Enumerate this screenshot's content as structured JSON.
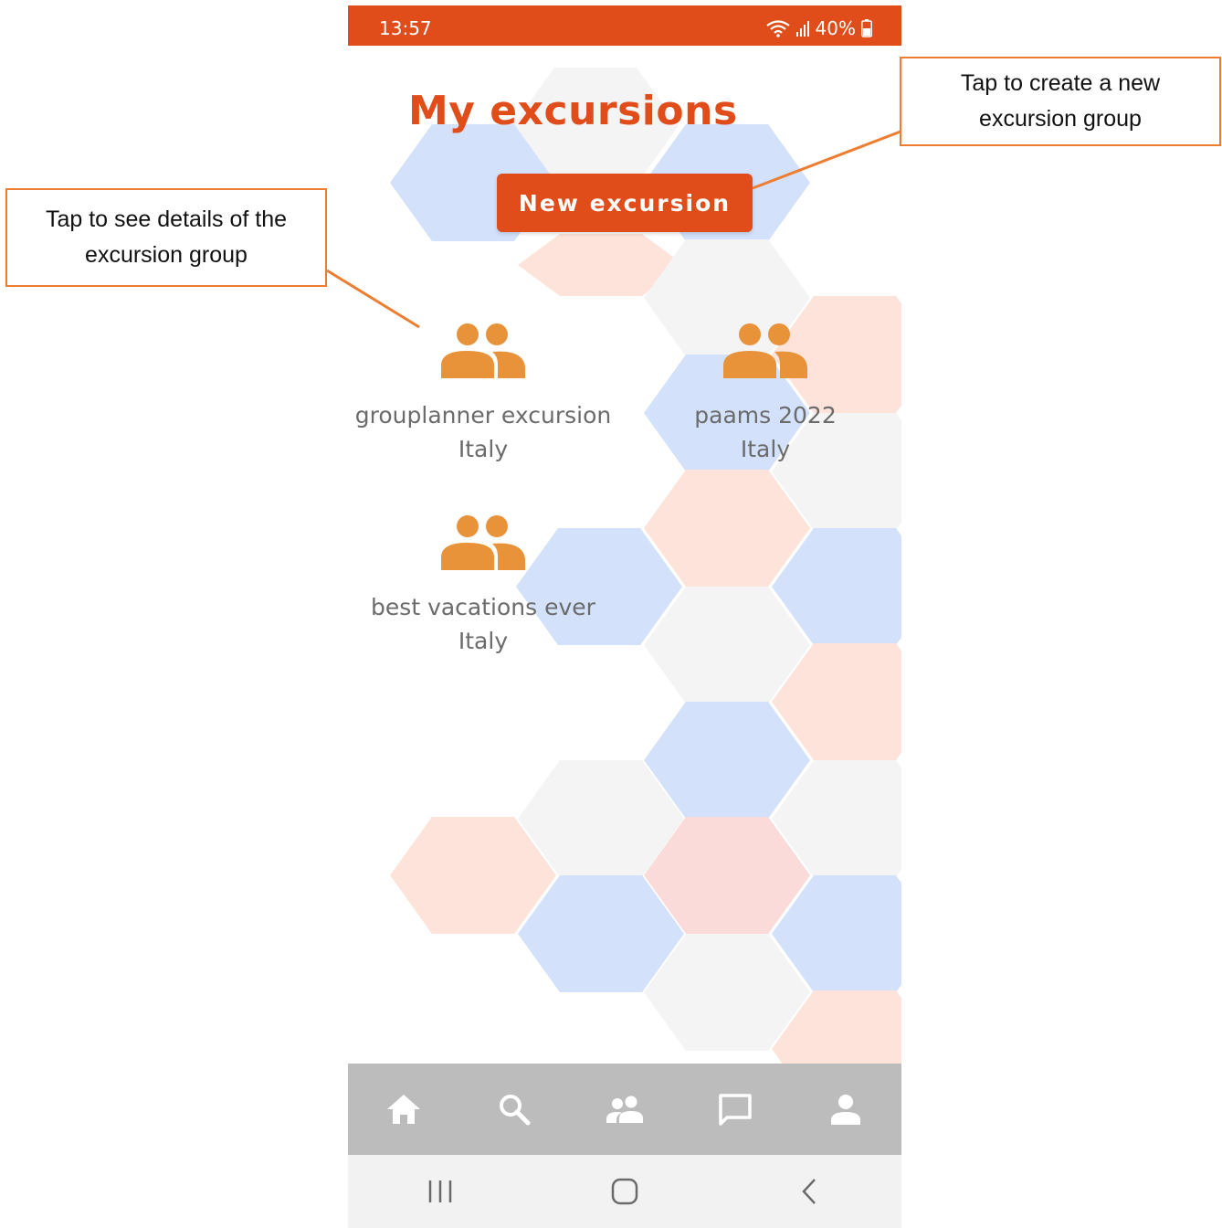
{
  "status_bar": {
    "time": "13:57",
    "battery": "40%"
  },
  "page": {
    "title": "My excursions"
  },
  "actions": {
    "new_excursion_label": "New excursion"
  },
  "groups": [
    {
      "name": "grouplanner excursion",
      "country": "Italy"
    },
    {
      "name": "paams 2022",
      "country": "Italy"
    },
    {
      "name": "best vacations ever",
      "country": "Italy"
    }
  ],
  "bottom_nav": [
    {
      "icon": "home-icon"
    },
    {
      "icon": "search-icon"
    },
    {
      "icon": "group-icon"
    },
    {
      "icon": "chat-icon"
    },
    {
      "icon": "profile-icon"
    }
  ],
  "system_nav": [
    {
      "icon": "recents-icon"
    },
    {
      "icon": "home-circle-icon"
    },
    {
      "icon": "back-icon"
    }
  ],
  "annotations": {
    "group_details_note": "Tap to see details of the excursion group",
    "new_group_note": "Tap to create a new excursion group"
  },
  "colors": {
    "accent": "#e04d1a",
    "group_icon": "#e8923a",
    "nav_bar": "#bcbcbc",
    "callout_border": "#ed7d31",
    "hex_blue": "#d3e1fb",
    "hex_peach": "#fde3da",
    "hex_gray": "#f4f4f4",
    "hex_pink": "#fbdada"
  }
}
